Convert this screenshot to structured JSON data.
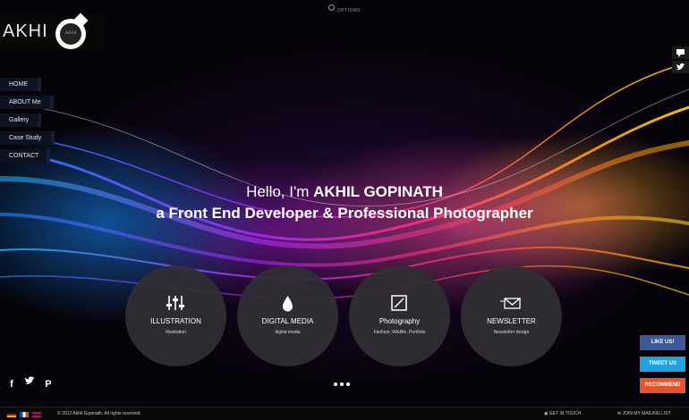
{
  "topbar": {
    "options_label": "OPTIONS"
  },
  "logo": {
    "wordmark": "AKHI",
    "badge_text": "Akhil"
  },
  "nav": {
    "items": [
      {
        "label": "HOME"
      },
      {
        "label": "ABOUT Me"
      },
      {
        "label": "Gallery"
      },
      {
        "label": "Case Study"
      },
      {
        "label": "CONTACT"
      }
    ]
  },
  "hero": {
    "line1_prefix": "Hello, I'm ",
    "line1_name": "AKHIL GOPINATH",
    "line2": "a Front End Developer & Professional Photographer"
  },
  "services": [
    {
      "icon": "sliders-icon",
      "title": "ILLUSTRATION",
      "subtitle": "Illustration"
    },
    {
      "icon": "droplet-icon",
      "title": "DIGITAL MEDIA",
      "subtitle": "digital media"
    },
    {
      "icon": "pencil-box-icon",
      "title": "Photography",
      "subtitle": "Fashion, Wildlife, Portfolio"
    },
    {
      "icon": "envelope-icon",
      "title": "NEWSLETTER",
      "subtitle": "Newsletter design"
    }
  ],
  "social": {
    "facebook": "f",
    "pinterest": "P"
  },
  "share": {
    "like": "LIKE US!",
    "tweet": "TWEET US",
    "recommend": "RECOMMEND"
  },
  "footer": {
    "copyright": "© 2012 Akhil Gopinath. All rights reserved.",
    "get_in_touch": "GET IN TOUCH",
    "join_list": "JOIN MY MAILING LIST"
  },
  "colors": {
    "like": "#3b5998",
    "tweet": "#1fa3e0",
    "recommend": "#e4542c",
    "circle": "#302e34"
  }
}
